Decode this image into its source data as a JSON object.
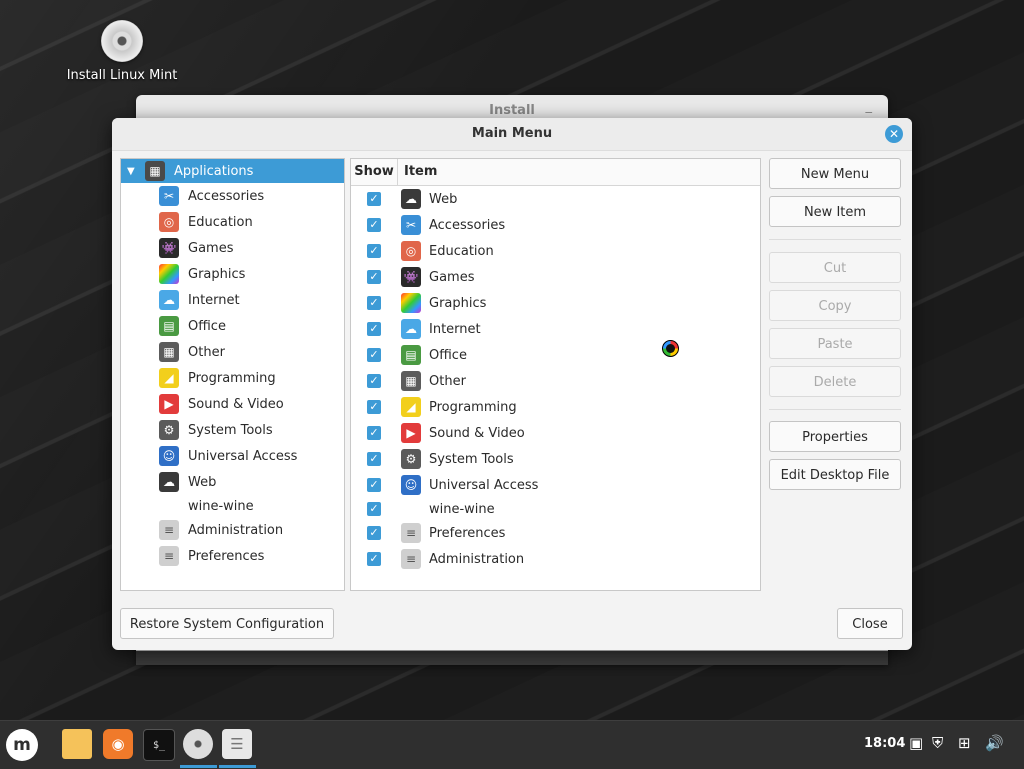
{
  "desktop": {
    "icon_label": "Install Linux Mint"
  },
  "install_window": {
    "title": "Install",
    "minimize": "_"
  },
  "dialog": {
    "title": "Main Menu",
    "close_glyph": "✕",
    "tree": {
      "root": "Applications",
      "children": [
        {
          "label": "Accessories",
          "icon": "scissors-icon",
          "color": "#3a8fd6",
          "glyph": "✂"
        },
        {
          "label": "Education",
          "icon": "education-icon",
          "color": "#e0664a",
          "glyph": "◎"
        },
        {
          "label": "Games",
          "icon": "gamepad-icon",
          "color": "#2a2a2a",
          "glyph": "👾"
        },
        {
          "label": "Graphics",
          "icon": "palette-icon",
          "color": "#c43fc4",
          "glyph": ""
        },
        {
          "label": "Internet",
          "icon": "cloud-icon",
          "color": "#4aa8e6",
          "glyph": "☁"
        },
        {
          "label": "Office",
          "icon": "document-icon",
          "color": "#4a9a42",
          "glyph": "▤"
        },
        {
          "label": "Other",
          "icon": "grid-icon",
          "color": "#5c5c5c",
          "glyph": "▦"
        },
        {
          "label": "Programming",
          "icon": "ruler-icon",
          "color": "#f2cf1c",
          "glyph": "◢"
        },
        {
          "label": "Sound & Video",
          "icon": "play-icon",
          "color": "#e23b3b",
          "glyph": "▶"
        },
        {
          "label": "System Tools",
          "icon": "gear-icon",
          "color": "#5a5a5a",
          "glyph": "⚙"
        },
        {
          "label": "Universal Access",
          "icon": "accessibility-icon",
          "color": "#2f6fc6",
          "glyph": "☺"
        },
        {
          "label": "Web",
          "icon": "web-cloud-icon",
          "color": "#3a3a3a",
          "glyph": "☁"
        },
        {
          "label": "wine-wine",
          "icon": "",
          "color": "transparent",
          "glyph": ""
        },
        {
          "label": "Administration",
          "icon": "toggle-icon",
          "color": "#cfcfcf",
          "glyph": "≡"
        },
        {
          "label": "Preferences",
          "icon": "toggle-icon",
          "color": "#cfcfcf",
          "glyph": "≡"
        }
      ]
    },
    "list": {
      "col_show": "Show",
      "col_item": "Item",
      "check_glyph": "✓",
      "rows": [
        {
          "label": "Web",
          "icon": "web-cloud-icon",
          "color": "#3a3a3a",
          "glyph": "☁"
        },
        {
          "label": "Accessories",
          "icon": "scissors-icon",
          "color": "#3a8fd6",
          "glyph": "✂"
        },
        {
          "label": "Education",
          "icon": "education-icon",
          "color": "#e0664a",
          "glyph": "◎"
        },
        {
          "label": "Games",
          "icon": "gamepad-icon",
          "color": "#2a2a2a",
          "glyph": "👾"
        },
        {
          "label": "Graphics",
          "icon": "palette-icon",
          "color": "#c43fc4",
          "glyph": ""
        },
        {
          "label": "Internet",
          "icon": "cloud-icon",
          "color": "#4aa8e6",
          "glyph": "☁"
        },
        {
          "label": "Office",
          "icon": "document-icon",
          "color": "#4a9a42",
          "glyph": "▤"
        },
        {
          "label": "Other",
          "icon": "grid-icon",
          "color": "#5c5c5c",
          "glyph": "▦"
        },
        {
          "label": "Programming",
          "icon": "ruler-icon",
          "color": "#f2cf1c",
          "glyph": "◢"
        },
        {
          "label": "Sound & Video",
          "icon": "play-icon",
          "color": "#e23b3b",
          "glyph": "▶"
        },
        {
          "label": "System Tools",
          "icon": "gear-icon",
          "color": "#5a5a5a",
          "glyph": "⚙"
        },
        {
          "label": "Universal Access",
          "icon": "accessibility-icon",
          "color": "#2f6fc6",
          "glyph": "☺"
        },
        {
          "label": "wine-wine",
          "icon": "",
          "color": "transparent",
          "glyph": ""
        },
        {
          "label": "Preferences",
          "icon": "toggle-icon",
          "color": "#cfcfcf",
          "glyph": "≡"
        },
        {
          "label": "Administration",
          "icon": "toggle-icon",
          "color": "#cfcfcf",
          "glyph": "≡"
        }
      ]
    },
    "buttons": {
      "new_menu": "New Menu",
      "new_item": "New Item",
      "cut": "Cut",
      "copy": "Copy",
      "paste": "Paste",
      "delete": "Delete",
      "properties": "Properties",
      "edit_desktop_file": "Edit Desktop File",
      "restore": "Restore System Configuration",
      "close": "Close"
    }
  },
  "taskbar": {
    "clock": "18:04",
    "menu_glyph": "m",
    "terminal_glyph": "$_",
    "accent": "#3d9bd6"
  }
}
